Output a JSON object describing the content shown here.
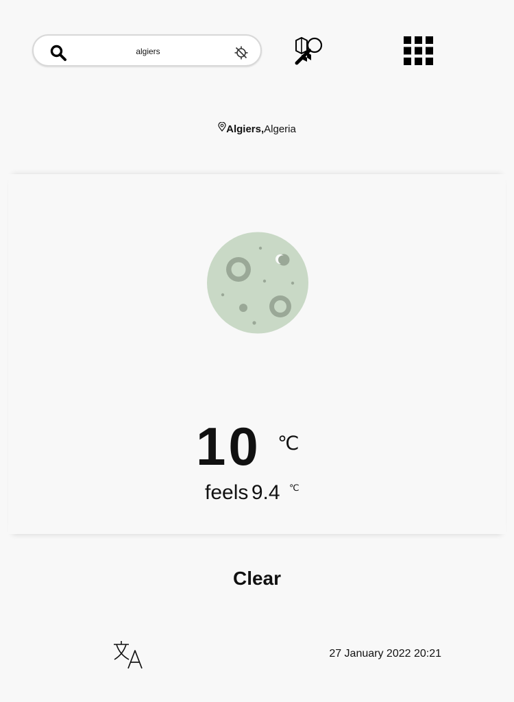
{
  "search": {
    "value": "algiers",
    "icon": "search-icon",
    "gps_icon": "gps-off-icon"
  },
  "toolbar": {
    "map_search_icon": "map-search-icon",
    "apps_icon": "apps-grid-icon"
  },
  "location": {
    "city": "Algiers,",
    "country": "Algeria",
    "icon": "pin-icon"
  },
  "weather": {
    "icon": "moon-clear-night-icon",
    "temperature": "10",
    "unit": "℃",
    "feels_label": "feels",
    "feels_value": "9.4",
    "feels_unit": "℃",
    "condition": "Clear"
  },
  "footer": {
    "language_icon": "translate-icon",
    "datetime": "27 January 2022 20:21"
  },
  "colors": {
    "moon": "#c9d9c6",
    "moon_spots": "#9aa897"
  }
}
